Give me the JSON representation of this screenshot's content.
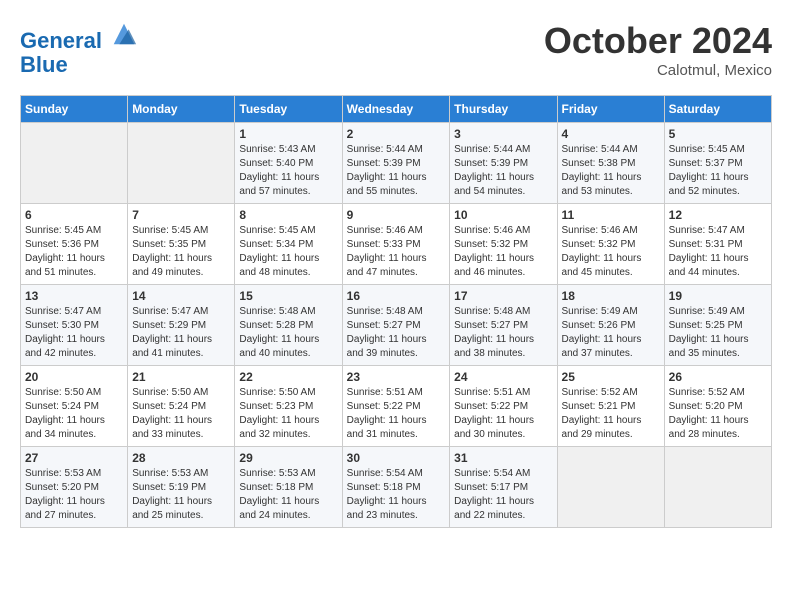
{
  "logo": {
    "line1": "General",
    "line2": "Blue"
  },
  "title": "October 2024",
  "subtitle": "Calotmul, Mexico",
  "weekdays": [
    "Sunday",
    "Monday",
    "Tuesday",
    "Wednesday",
    "Thursday",
    "Friday",
    "Saturday"
  ],
  "weeks": [
    [
      {
        "day": "",
        "sunrise": "",
        "sunset": "",
        "daylight": ""
      },
      {
        "day": "",
        "sunrise": "",
        "sunset": "",
        "daylight": ""
      },
      {
        "day": "1",
        "sunrise": "Sunrise: 5:43 AM",
        "sunset": "Sunset: 5:40 PM",
        "daylight": "Daylight: 11 hours and 57 minutes."
      },
      {
        "day": "2",
        "sunrise": "Sunrise: 5:44 AM",
        "sunset": "Sunset: 5:39 PM",
        "daylight": "Daylight: 11 hours and 55 minutes."
      },
      {
        "day": "3",
        "sunrise": "Sunrise: 5:44 AM",
        "sunset": "Sunset: 5:39 PM",
        "daylight": "Daylight: 11 hours and 54 minutes."
      },
      {
        "day": "4",
        "sunrise": "Sunrise: 5:44 AM",
        "sunset": "Sunset: 5:38 PM",
        "daylight": "Daylight: 11 hours and 53 minutes."
      },
      {
        "day": "5",
        "sunrise": "Sunrise: 5:45 AM",
        "sunset": "Sunset: 5:37 PM",
        "daylight": "Daylight: 11 hours and 52 minutes."
      }
    ],
    [
      {
        "day": "6",
        "sunrise": "Sunrise: 5:45 AM",
        "sunset": "Sunset: 5:36 PM",
        "daylight": "Daylight: 11 hours and 51 minutes."
      },
      {
        "day": "7",
        "sunrise": "Sunrise: 5:45 AM",
        "sunset": "Sunset: 5:35 PM",
        "daylight": "Daylight: 11 hours and 49 minutes."
      },
      {
        "day": "8",
        "sunrise": "Sunrise: 5:45 AM",
        "sunset": "Sunset: 5:34 PM",
        "daylight": "Daylight: 11 hours and 48 minutes."
      },
      {
        "day": "9",
        "sunrise": "Sunrise: 5:46 AM",
        "sunset": "Sunset: 5:33 PM",
        "daylight": "Daylight: 11 hours and 47 minutes."
      },
      {
        "day": "10",
        "sunrise": "Sunrise: 5:46 AM",
        "sunset": "Sunset: 5:32 PM",
        "daylight": "Daylight: 11 hours and 46 minutes."
      },
      {
        "day": "11",
        "sunrise": "Sunrise: 5:46 AM",
        "sunset": "Sunset: 5:32 PM",
        "daylight": "Daylight: 11 hours and 45 minutes."
      },
      {
        "day": "12",
        "sunrise": "Sunrise: 5:47 AM",
        "sunset": "Sunset: 5:31 PM",
        "daylight": "Daylight: 11 hours and 44 minutes."
      }
    ],
    [
      {
        "day": "13",
        "sunrise": "Sunrise: 5:47 AM",
        "sunset": "Sunset: 5:30 PM",
        "daylight": "Daylight: 11 hours and 42 minutes."
      },
      {
        "day": "14",
        "sunrise": "Sunrise: 5:47 AM",
        "sunset": "Sunset: 5:29 PM",
        "daylight": "Daylight: 11 hours and 41 minutes."
      },
      {
        "day": "15",
        "sunrise": "Sunrise: 5:48 AM",
        "sunset": "Sunset: 5:28 PM",
        "daylight": "Daylight: 11 hours and 40 minutes."
      },
      {
        "day": "16",
        "sunrise": "Sunrise: 5:48 AM",
        "sunset": "Sunset: 5:27 PM",
        "daylight": "Daylight: 11 hours and 39 minutes."
      },
      {
        "day": "17",
        "sunrise": "Sunrise: 5:48 AM",
        "sunset": "Sunset: 5:27 PM",
        "daylight": "Daylight: 11 hours and 38 minutes."
      },
      {
        "day": "18",
        "sunrise": "Sunrise: 5:49 AM",
        "sunset": "Sunset: 5:26 PM",
        "daylight": "Daylight: 11 hours and 37 minutes."
      },
      {
        "day": "19",
        "sunrise": "Sunrise: 5:49 AM",
        "sunset": "Sunset: 5:25 PM",
        "daylight": "Daylight: 11 hours and 35 minutes."
      }
    ],
    [
      {
        "day": "20",
        "sunrise": "Sunrise: 5:50 AM",
        "sunset": "Sunset: 5:24 PM",
        "daylight": "Daylight: 11 hours and 34 minutes."
      },
      {
        "day": "21",
        "sunrise": "Sunrise: 5:50 AM",
        "sunset": "Sunset: 5:24 PM",
        "daylight": "Daylight: 11 hours and 33 minutes."
      },
      {
        "day": "22",
        "sunrise": "Sunrise: 5:50 AM",
        "sunset": "Sunset: 5:23 PM",
        "daylight": "Daylight: 11 hours and 32 minutes."
      },
      {
        "day": "23",
        "sunrise": "Sunrise: 5:51 AM",
        "sunset": "Sunset: 5:22 PM",
        "daylight": "Daylight: 11 hours and 31 minutes."
      },
      {
        "day": "24",
        "sunrise": "Sunrise: 5:51 AM",
        "sunset": "Sunset: 5:22 PM",
        "daylight": "Daylight: 11 hours and 30 minutes."
      },
      {
        "day": "25",
        "sunrise": "Sunrise: 5:52 AM",
        "sunset": "Sunset: 5:21 PM",
        "daylight": "Daylight: 11 hours and 29 minutes."
      },
      {
        "day": "26",
        "sunrise": "Sunrise: 5:52 AM",
        "sunset": "Sunset: 5:20 PM",
        "daylight": "Daylight: 11 hours and 28 minutes."
      }
    ],
    [
      {
        "day": "27",
        "sunrise": "Sunrise: 5:53 AM",
        "sunset": "Sunset: 5:20 PM",
        "daylight": "Daylight: 11 hours and 27 minutes."
      },
      {
        "day": "28",
        "sunrise": "Sunrise: 5:53 AM",
        "sunset": "Sunset: 5:19 PM",
        "daylight": "Daylight: 11 hours and 25 minutes."
      },
      {
        "day": "29",
        "sunrise": "Sunrise: 5:53 AM",
        "sunset": "Sunset: 5:18 PM",
        "daylight": "Daylight: 11 hours and 24 minutes."
      },
      {
        "day": "30",
        "sunrise": "Sunrise: 5:54 AM",
        "sunset": "Sunset: 5:18 PM",
        "daylight": "Daylight: 11 hours and 23 minutes."
      },
      {
        "day": "31",
        "sunrise": "Sunrise: 5:54 AM",
        "sunset": "Sunset: 5:17 PM",
        "daylight": "Daylight: 11 hours and 22 minutes."
      },
      {
        "day": "",
        "sunrise": "",
        "sunset": "",
        "daylight": ""
      },
      {
        "day": "",
        "sunrise": "",
        "sunset": "",
        "daylight": ""
      }
    ]
  ]
}
